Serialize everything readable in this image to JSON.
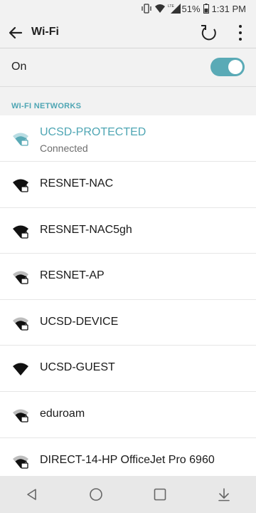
{
  "status_bar": {
    "battery": "51%",
    "time": "1:31 PM"
  },
  "app_bar": {
    "title": "Wi-Fi"
  },
  "toggle": {
    "label": "On",
    "state": "on",
    "accent": "#5aaab6"
  },
  "section": {
    "title": "WI-FI NETWORKS"
  },
  "networks": [
    {
      "name": "UCSD-PROTECTED",
      "status": "Connected",
      "secured": true,
      "strength": "medium"
    },
    {
      "name": "RESNET-NAC",
      "secured": true,
      "strength": "full"
    },
    {
      "name": "RESNET-NAC5gh",
      "secured": true,
      "strength": "full"
    },
    {
      "name": "RESNET-AP",
      "secured": true,
      "strength": "medium"
    },
    {
      "name": "UCSD-DEVICE",
      "secured": true,
      "strength": "medium"
    },
    {
      "name": "UCSD-GUEST",
      "secured": false,
      "strength": "full"
    },
    {
      "name": "eduroam",
      "secured": true,
      "strength": "medium"
    },
    {
      "name": "DIRECT-14-HP OfficeJet Pro 6960",
      "secured": true,
      "strength": "medium"
    }
  ],
  "nav": {
    "buttons": [
      "back-triangle-icon",
      "home-circle-icon",
      "recents-square-icon",
      "notification-down-icon"
    ]
  }
}
